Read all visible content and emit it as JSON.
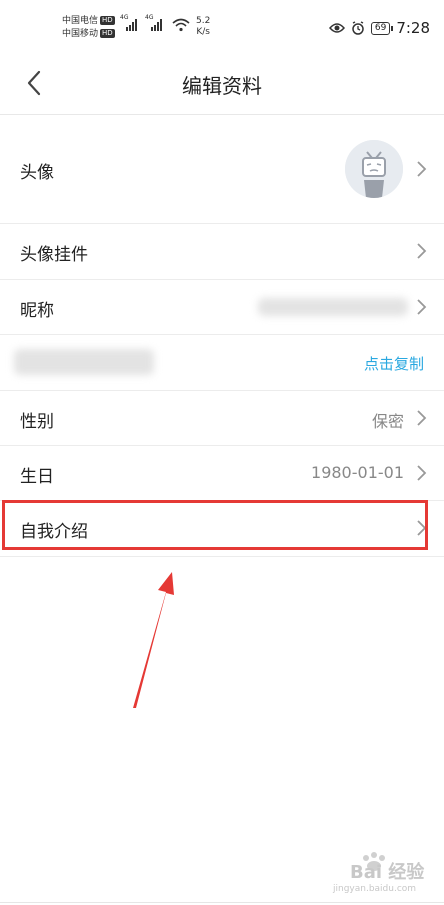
{
  "statusbar": {
    "carrier1": "中国电信",
    "carrier2": "中国移动",
    "hd": "HD",
    "net1": "4G",
    "net2": "4G",
    "speed_value": "5.2",
    "speed_unit": "K/s",
    "battery": "69",
    "time": "7:28"
  },
  "navbar": {
    "title": "编辑资料"
  },
  "rows": {
    "avatar": {
      "label": "头像"
    },
    "pendant": {
      "label": "头像挂件"
    },
    "nickname": {
      "label": "昵称"
    },
    "uid": {
      "action": "点击复制"
    },
    "gender": {
      "label": "性别",
      "value": "保密"
    },
    "birthday": {
      "label": "生日",
      "value": "1980-01-01"
    },
    "bio": {
      "label": "自我介绍"
    }
  },
  "watermark": {
    "text": "Bai 经验",
    "sub": "jingyan.baidu.com"
  },
  "colors": {
    "accent": "#2aa8e0",
    "annotation": "#e53935"
  }
}
